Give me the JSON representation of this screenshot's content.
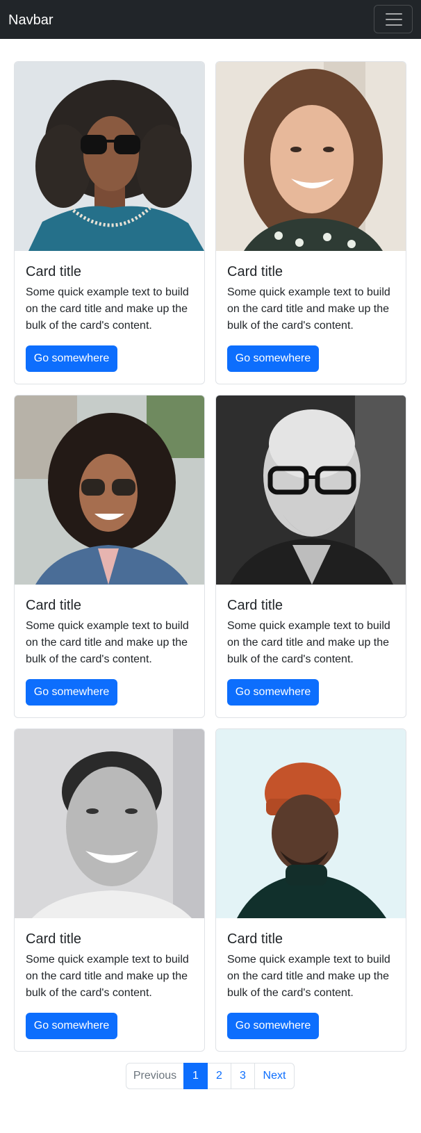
{
  "navbar": {
    "brand": "Navbar",
    "toggler_icon": "hamburger-menu-icon",
    "background": "#212529"
  },
  "cards": [
    {
      "title": "Card title",
      "text": "Some quick example text to build on the card title and make up the bulk of the card's content.",
      "button": "Go somewhere",
      "image": "portrait-man-curly-hair-sunglasses"
    },
    {
      "title": "Card title",
      "text": "Some quick example text to build on the card title and make up the bulk of the card's content.",
      "button": "Go somewhere",
      "image": "portrait-smiling-woman-brown-hair"
    },
    {
      "title": "Card title",
      "text": "Some quick example text to build on the card title and make up the bulk of the card's content.",
      "button": "Go somewhere",
      "image": "portrait-woman-curly-hair-sunglasses"
    },
    {
      "title": "Card title",
      "text": "Some quick example text to build on the card title and make up the bulk of the card's content.",
      "button": "Go somewhere",
      "image": "portrait-bald-man-glasses-bw"
    },
    {
      "title": "Card title",
      "text": "Some quick example text to build on the card title and make up the bulk of the card's content.",
      "button": "Go somewhere",
      "image": "portrait-smiling-man-bw"
    },
    {
      "title": "Card title",
      "text": "Some quick example text to build on the card title and make up the bulk of the card's content.",
      "button": "Go somewhere",
      "image": "portrait-man-orange-beanie"
    }
  ],
  "pagination": {
    "previous": "Previous",
    "pages": [
      "1",
      "2",
      "3"
    ],
    "active_page": "1",
    "next": "Next"
  },
  "colors": {
    "primary": "#0d6efd",
    "disabled_text": "#6c757d",
    "border": "#dee2e6"
  }
}
